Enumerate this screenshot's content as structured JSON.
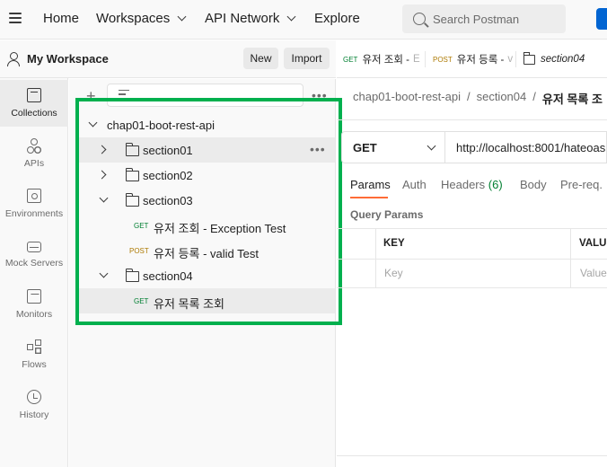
{
  "topbar": {
    "nav": [
      "Home",
      "Workspaces",
      "API Network",
      "Explore"
    ],
    "search_placeholder": "Search Postman"
  },
  "rail": {
    "items": [
      {
        "label": "Collections",
        "icon": "collections-icon"
      },
      {
        "label": "APIs",
        "icon": "apis-icon"
      },
      {
        "label": "Environments",
        "icon": "environments-icon"
      },
      {
        "label": "Mock Servers",
        "icon": "mock-servers-icon"
      },
      {
        "label": "Monitors",
        "icon": "monitors-icon"
      },
      {
        "label": "Flows",
        "icon": "flows-icon"
      },
      {
        "label": "History",
        "icon": "history-icon"
      }
    ]
  },
  "workspace": {
    "title": "My Workspace",
    "new_label": "New",
    "import_label": "Import"
  },
  "tree": {
    "collection": "chap01-boot-rest-api",
    "folders": [
      "section01",
      "section02",
      "section03",
      "section04"
    ],
    "requests": [
      {
        "method": "GET",
        "name": "유저 조회 - Exception Test"
      },
      {
        "method": "POST",
        "name": "유저 등록 - valid Test"
      },
      {
        "method": "GET",
        "name": "유저 목록 조회"
      }
    ]
  },
  "tabs": [
    {
      "method": "GET",
      "name": "유저 조회 -",
      "fade": "E"
    },
    {
      "method": "POST",
      "name": "유저 등록 -",
      "fade": "v"
    },
    {
      "method": "",
      "name": "section04",
      "fade": ""
    }
  ],
  "breadcrumb": {
    "collection": "chap01-boot-rest-api",
    "folder": "section04",
    "request": "유저 목록 조",
    "sep": "/"
  },
  "request": {
    "method": "GET",
    "url": "http://localhost:8001/hateoas"
  },
  "param_tabs": {
    "params": "Params",
    "auth": "Auth",
    "headers": "Headers",
    "headers_count": "(6)",
    "body": "Body",
    "prereq": "Pre-req."
  },
  "query_params": {
    "title": "Query Params",
    "key_header": "KEY",
    "value_header": "VALU",
    "key_placeholder": "Key",
    "value_placeholder": "Value"
  },
  "colors": {
    "get": "#007f31",
    "post": "#ad7a03",
    "accent": "#ff6c37",
    "highlight": "#00b04e",
    "brand_blue": "#0265d2"
  }
}
